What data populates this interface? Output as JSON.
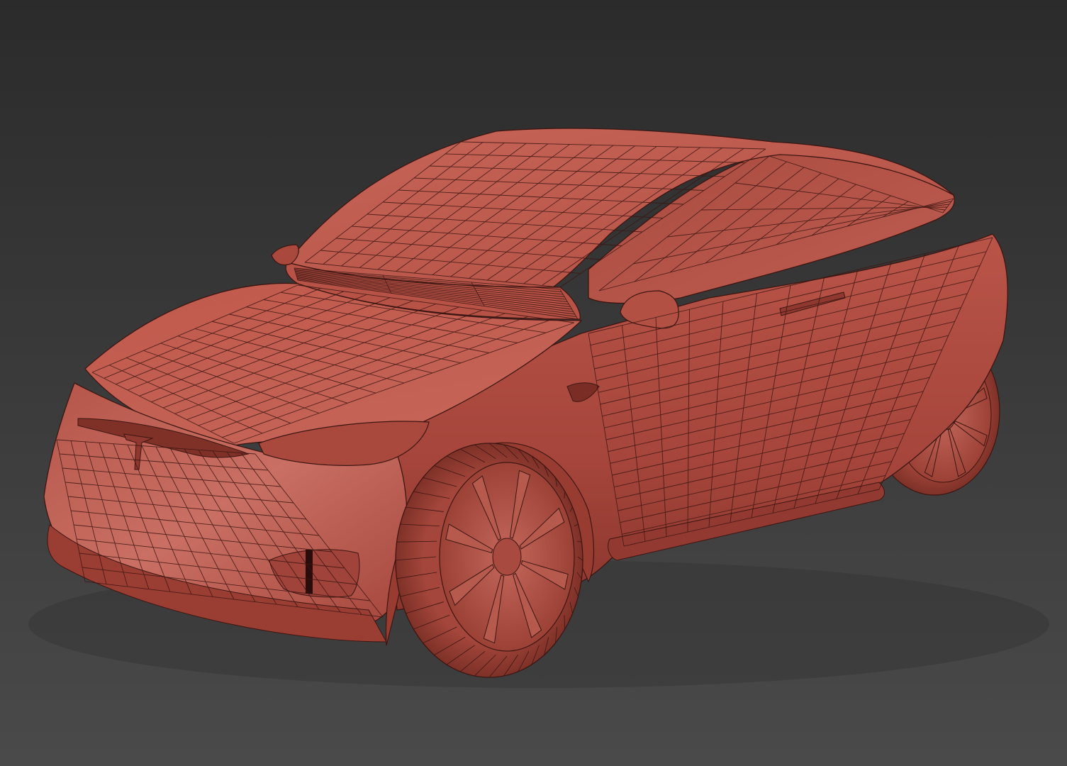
{
  "scene": {
    "subject": "car-wireframe-model",
    "colors": {
      "background_top": "#2b2b2b",
      "background_bottom": "#4a4a4a",
      "body_light": "#c8655a",
      "body_mid": "#b35247",
      "body_dark": "#7e3129",
      "tire": "#9c4036",
      "rim": "#b85a4f",
      "wire": "#3d1612"
    }
  }
}
